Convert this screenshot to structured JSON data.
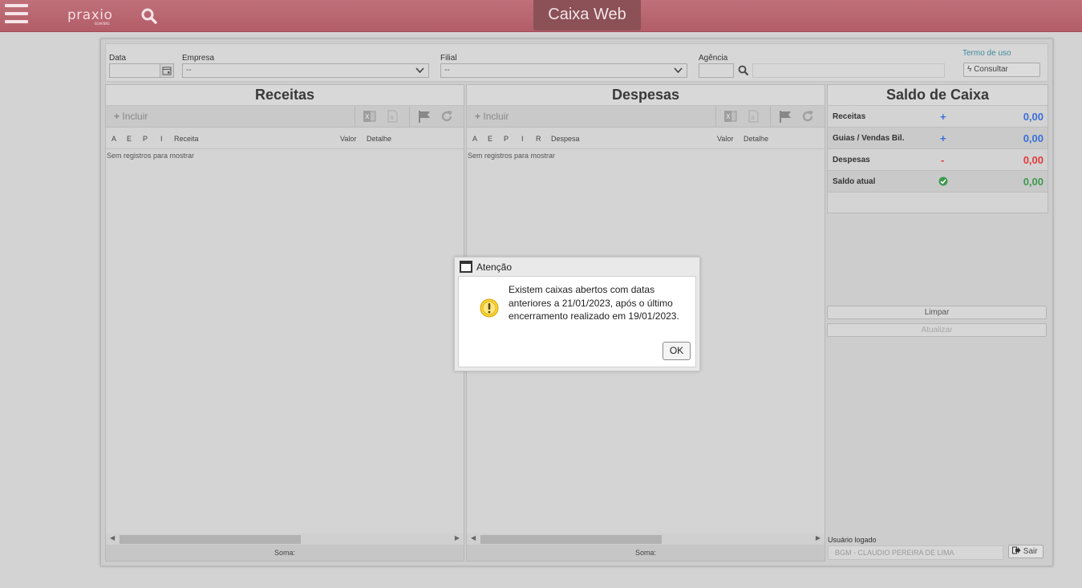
{
  "header": {
    "logo_text": "praxio",
    "logo_sub": "BGM/BNS",
    "app_title": "Caixa Web"
  },
  "filters": {
    "data_label": "Data",
    "data_value": "",
    "empresa_label": "Empresa",
    "empresa_value": "--",
    "filial_label": "Filial",
    "filial_value": "--",
    "agencia_label": "Agência",
    "agencia_value": "",
    "agencia_desc": "",
    "termo_link": "Termo de uso",
    "consultar_label": "Consultar"
  },
  "receitas": {
    "title": "Receitas",
    "incluir_label": "Incluir",
    "headers": [
      "A",
      "E",
      "P",
      "I",
      "Receita",
      "Valor",
      "Detalhe"
    ],
    "empty_message": "Sem registros para mostrar",
    "soma_label": "Soma:"
  },
  "despesas": {
    "title": "Despesas",
    "incluir_label": "Incluir",
    "headers": [
      "A",
      "E",
      "P",
      "I",
      "R",
      "Despesa",
      "Valor",
      "Detalhe"
    ],
    "empty_message": "Sem registros para mostrar",
    "soma_label": "Soma:"
  },
  "saldo": {
    "title": "Saldo de Caixa",
    "rows": [
      {
        "label": "Receitas",
        "sign": "+",
        "value": "0,00",
        "color": "#3a6fd8"
      },
      {
        "label": "Guias / Vendas Bil.",
        "sign": "+",
        "value": "0,00",
        "color": "#3a6fd8"
      },
      {
        "label": "Despesas",
        "sign": "-",
        "value": "0,00",
        "color": "#e03b3b"
      },
      {
        "label": "Saldo atual",
        "sign": "check-circle-icon",
        "value": "0,00",
        "color": "#3e9a4d"
      }
    ],
    "limpar_label": "Limpar",
    "atualizar_label": "Atualizar",
    "usuario_label": "Usuário logado",
    "usuario_value": "BGM - CLAUDIO PEREIRA DE LIMA",
    "sair_label": "Sair"
  },
  "dialog": {
    "title": "Atenção",
    "message": "Existem caixas abertos com datas anteriores a 21/01/2023, após o último encerramento realizado em 19/01/2023.",
    "ok_label": "OK",
    "icon": "warning-icon"
  },
  "colors": {
    "topbar": "#b9646f",
    "title_bg": "#8b5157",
    "positive": "#3a6fd8",
    "negative": "#e03b3b",
    "balance": "#3e9a4d"
  }
}
